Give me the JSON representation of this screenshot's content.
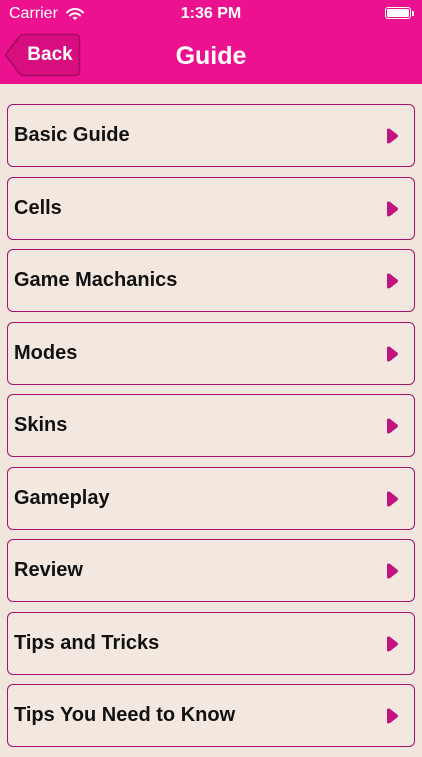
{
  "status_bar": {
    "carrier": "Carrier",
    "time": "1:36 PM",
    "wifi_icon": "wifi-icon",
    "battery_icon": "battery-icon",
    "battery_level": 1.0
  },
  "nav": {
    "back_label": "Back",
    "title": "Guide"
  },
  "colors": {
    "brand": "#ec118f",
    "border": "#a8126c",
    "background": "#f0e6de",
    "chevron": "#c2147e"
  },
  "items": [
    {
      "label": "Basic Guide",
      "icon": "chevron-right-icon"
    },
    {
      "label": "Cells",
      "icon": "chevron-right-icon"
    },
    {
      "label": "Game Machanics",
      "icon": "chevron-right-icon"
    },
    {
      "label": "Modes",
      "icon": "chevron-right-icon"
    },
    {
      "label": "Skins",
      "icon": "chevron-right-icon"
    },
    {
      "label": "Gameplay",
      "icon": "chevron-right-icon"
    },
    {
      "label": "Review",
      "icon": "chevron-right-icon"
    },
    {
      "label": "Tips and Tricks",
      "icon": "chevron-right-icon"
    },
    {
      "label": "Tips You Need to Know",
      "icon": "chevron-right-icon"
    }
  ]
}
